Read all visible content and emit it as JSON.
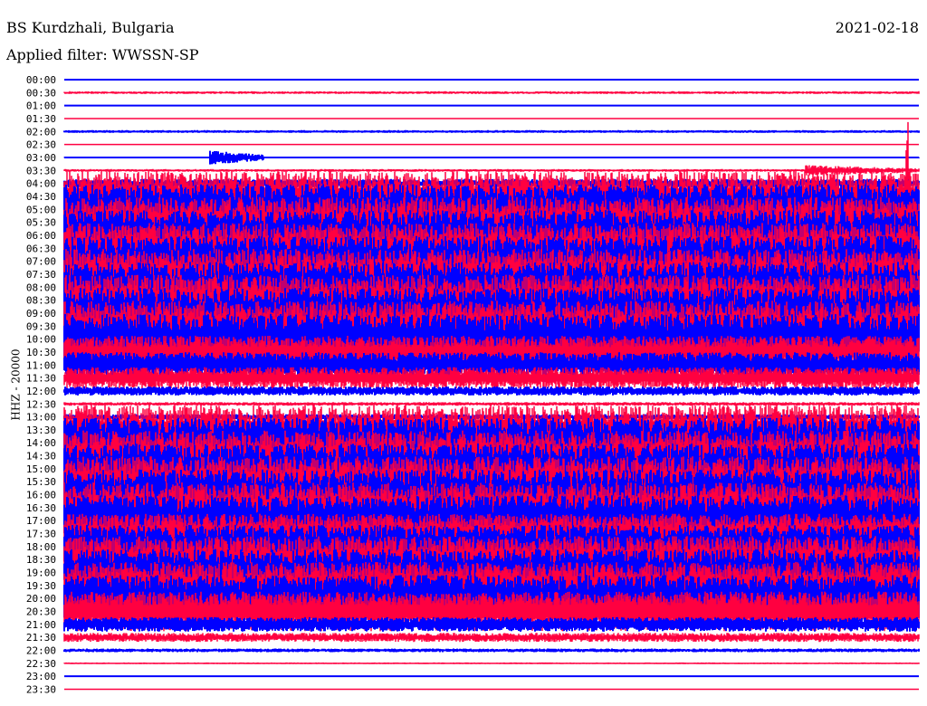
{
  "header": {
    "station": "BS Kurdzhali, Bulgaria",
    "filter": "Applied filter: WWSSN-SP",
    "date": "2021-02-18"
  },
  "chart_data": {
    "type": "line",
    "title": "BS Kurdzhali, Bulgaria",
    "subtitle": "Applied filter: WWSSN-SP",
    "date": "2021-02-18",
    "ylabel": "HHZ - 20000",
    "xlabel": "",
    "series_colors": [
      "#0000ff",
      "#ff0040"
    ],
    "tick_labels": [
      "00:00",
      "00:30",
      "01:00",
      "01:30",
      "02:00",
      "02:30",
      "03:00",
      "03:30",
      "04:00",
      "04:30",
      "05:00",
      "05:30",
      "06:00",
      "06:30",
      "07:00",
      "07:30",
      "08:00",
      "08:30",
      "09:00",
      "09:30",
      "10:00",
      "10:30",
      "11:00",
      "11:30",
      "12:00",
      "12:30",
      "13:00",
      "13:30",
      "14:00",
      "14:30",
      "15:00",
      "15:30",
      "16:00",
      "16:30",
      "17:00",
      "17:30",
      "18:00",
      "18:30",
      "19:00",
      "19:30",
      "20:00",
      "20:30",
      "21:00",
      "21:30",
      "22:00",
      "22:30",
      "23:00",
      "23:30"
    ],
    "relative_amplitude": [
      0.5,
      1.5,
      0.5,
      0.5,
      1.5,
      0.5,
      0.8,
      1.5,
      5,
      28,
      28,
      28,
      28,
      28,
      28,
      28,
      28,
      28,
      28,
      28,
      28,
      18,
      14,
      12,
      5,
      2,
      3,
      28,
      28,
      28,
      28,
      28,
      28,
      28,
      28,
      22,
      24,
      26,
      26,
      26,
      26,
      22,
      8,
      5,
      2,
      1,
      0.5,
      0.5
    ],
    "events": [
      {
        "trace": "03:00",
        "minute_start": 5.1,
        "minute_end": 7.0,
        "relative_amplitude": 8
      },
      {
        "trace": "03:30",
        "minute_start": 26.0,
        "minute_end": 30.0,
        "relative_amplitude": 6
      },
      {
        "trace": "03:30",
        "minute": 29.6,
        "relative_amplitude": 70
      }
    ]
  }
}
